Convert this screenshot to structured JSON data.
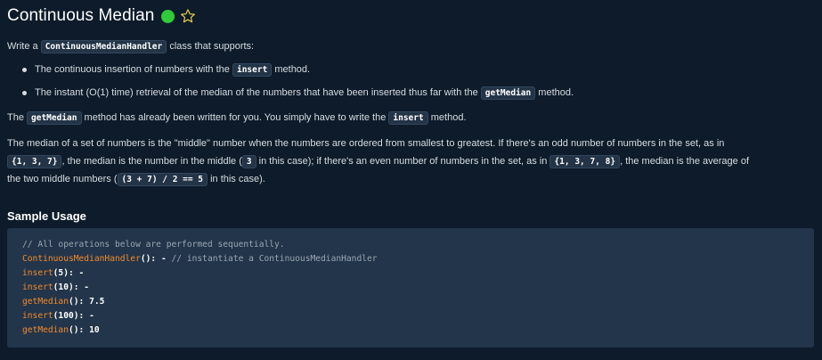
{
  "header": {
    "title": "Continuous Median",
    "status_color": "#2fcc3a",
    "favorite_icon": "star-outline-icon"
  },
  "intro": {
    "p1": [
      "Write a ",
      "ContinuousMedianHandler",
      " class that supports:"
    ],
    "bullet1": [
      "The continuous insertion of numbers with the ",
      "insert",
      " method."
    ],
    "bullet2": [
      "The instant (O(1) time) retrieval of the median of the numbers that have been inserted thus far with the ",
      "getMedian",
      " method."
    ],
    "p2": [
      "The ",
      "getMedian",
      " method has already been written for you. You simply have to write the ",
      "insert",
      " method."
    ],
    "p3_line1": "The median of a set of numbers is the \"middle\" number when the numbers are ordered from smallest to greatest. If there's an odd number of numbers in the set, as in",
    "p3_line2": [
      "{1, 3, 7}",
      ", the median is the number in the middle (",
      "3",
      " in this case); if there's an even number of numbers in the set, as in ",
      "{1, 3, 7, 8}",
      ", the median is the average of"
    ],
    "p3_line3": [
      "the two middle numbers (",
      "(3 + 7) / 2 == 5",
      " in this case)."
    ]
  },
  "sample": {
    "heading": "Sample Usage",
    "lines": [
      {
        "comment": "// All operations below are performed sequentially."
      },
      {
        "fn": "ContinuousMedianHandler",
        "rest": "(): - ",
        "comment": "// instantiate a ContinuousMedianHandler"
      },
      {
        "fn": "insert",
        "rest": "(5): -"
      },
      {
        "fn": "insert",
        "rest": "(10): -"
      },
      {
        "fn": "getMedian",
        "rest": "(): 7.5"
      },
      {
        "fn": "insert",
        "rest": "(100): -"
      },
      {
        "fn": "getMedian",
        "rest": "(): 10"
      }
    ]
  }
}
